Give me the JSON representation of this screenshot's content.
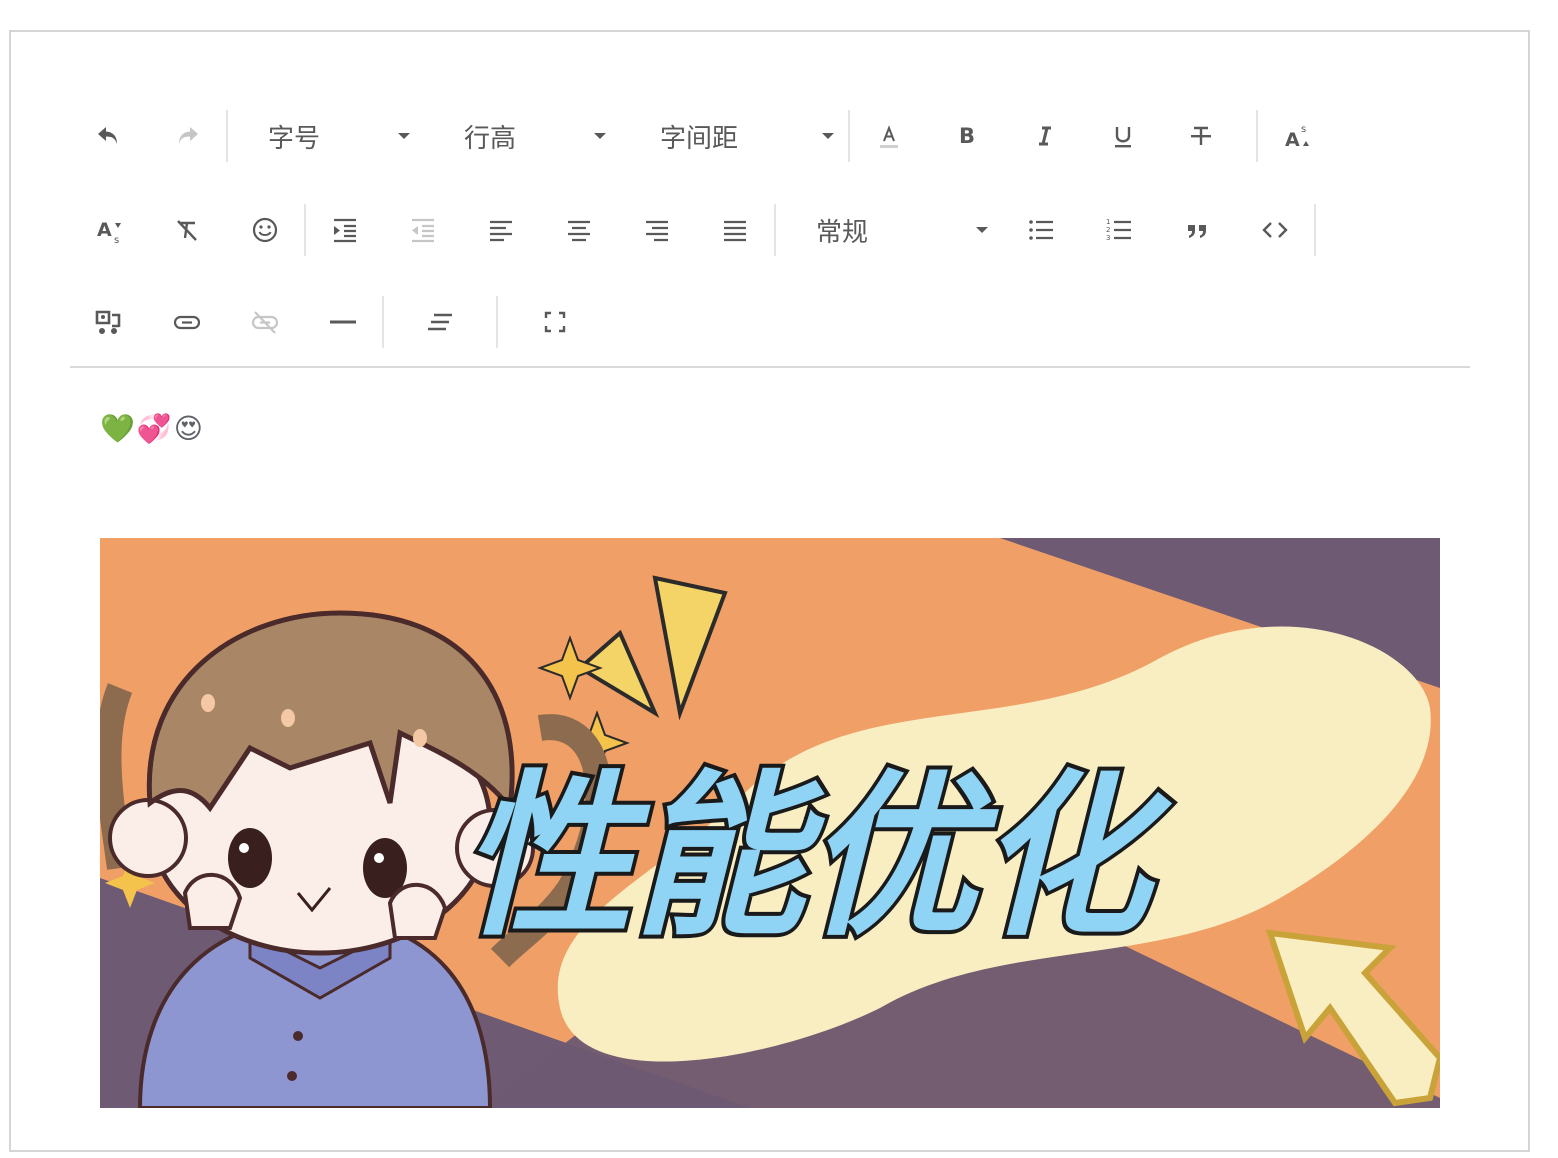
{
  "toolbar": {
    "font_size_label": "字号",
    "line_height_label": "行高",
    "letter_spacing_label": "字间距",
    "heading_label": "常规"
  },
  "content": {
    "emojis": [
      "💚",
      "💞",
      "😍"
    ],
    "banner_title": "性能优化"
  },
  "colors": {
    "icon": "#595959",
    "icon_disabled": "#c6c6c6",
    "banner_orange": "#f0a067",
    "banner_purple": "#6e5a72",
    "banner_cream": "#f8eec1",
    "text_blue": "#8fd4f5"
  },
  "icons": [
    "undo-icon",
    "redo-icon",
    "font-color-icon",
    "bold-icon",
    "italic-icon",
    "underline-icon",
    "strikethrough-icon",
    "superscript-icon",
    "subscript-icon",
    "clear-format-icon",
    "emoji-icon",
    "indent-icon",
    "outdent-icon",
    "align-left-icon",
    "align-center-icon",
    "align-right-icon",
    "align-justify-icon",
    "bullet-list-icon",
    "ordered-list-icon",
    "quote-icon",
    "code-icon",
    "media-icon",
    "link-icon",
    "unlink-icon",
    "horizontal-rule-icon",
    "text-format-icon",
    "fullscreen-icon"
  ]
}
